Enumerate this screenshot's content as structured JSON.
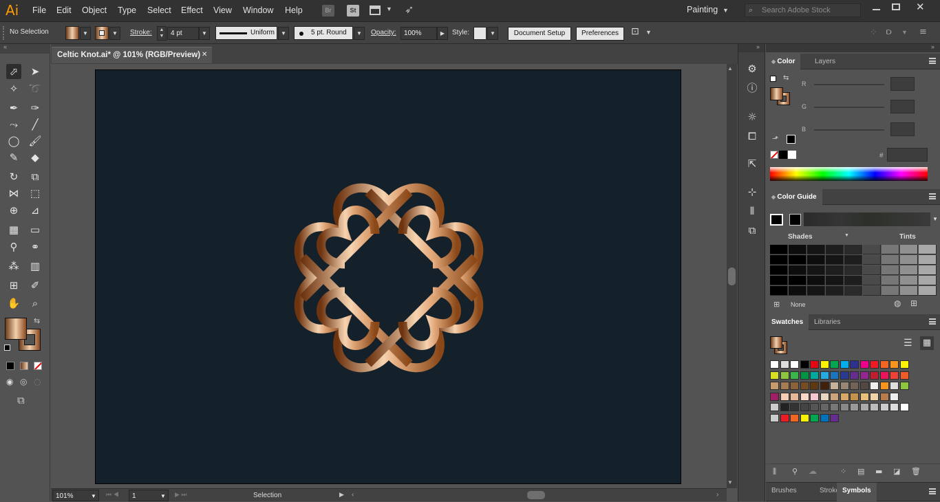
{
  "app": {
    "logo": "Ai",
    "workspace": "Painting",
    "search_placeholder": "Search Adobe Stock"
  },
  "menus": [
    "File",
    "Edit",
    "Object",
    "Type",
    "Select",
    "Effect",
    "View",
    "Window",
    "Help"
  ],
  "menubar_icons": [
    "bridge-icon",
    "stock-icon",
    "arrange-documents-icon",
    "gpu-rocket-icon"
  ],
  "control": {
    "selection": "No Selection",
    "stroke_label": "Stroke:",
    "stroke_weight": "4 pt",
    "profile": "Uniform",
    "brush": "5 pt. Round",
    "opacity_label": "Opacity:",
    "opacity": "100%",
    "style_label": "Style:",
    "doc_setup": "Document Setup",
    "preferences": "Preferences"
  },
  "document": {
    "tab_title": "Celtic Knot.ai* @ 101% (RGB/Preview)",
    "close": "✕"
  },
  "status": {
    "zoom": "101%",
    "artboard": "1",
    "tool": "Selection"
  },
  "panels": {
    "color": {
      "tab": "Color",
      "tab2": "Layers",
      "channels": [
        "R",
        "G",
        "B"
      ],
      "hash": "#"
    },
    "guide": {
      "title": "Color Guide",
      "shades": "Shades",
      "tints": "Tints",
      "none": "None"
    },
    "swatches": {
      "tab": "Swatches",
      "tab2": "Libraries"
    },
    "bottom_tabs": [
      "Brushes",
      "Stroke",
      "Symbols"
    ]
  },
  "colors": {
    "artboard": "#14202a",
    "copper_light": "#f2c8a0",
    "copper_dark": "#7a3d14",
    "accent": "#ff9a00"
  }
}
